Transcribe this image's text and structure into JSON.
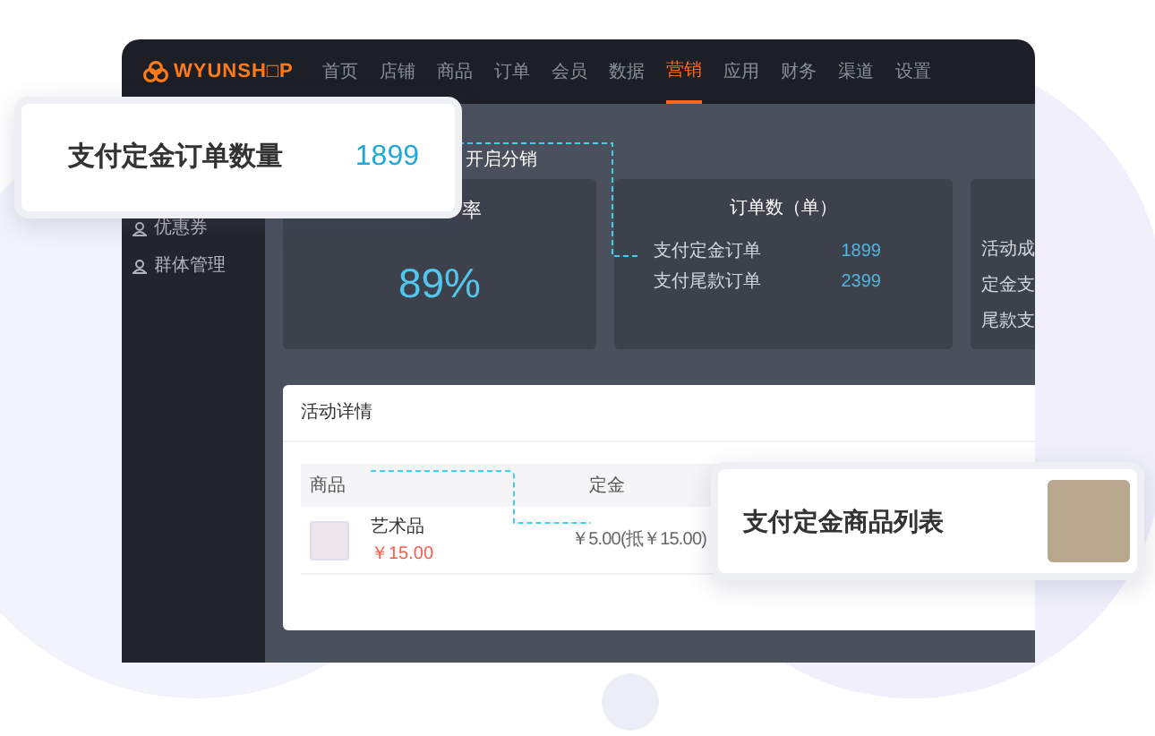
{
  "brand": "WYUNSH□P",
  "nav": [
    {
      "label": "首页",
      "selected": false
    },
    {
      "label": "店铺",
      "selected": false
    },
    {
      "label": "商品",
      "selected": false
    },
    {
      "label": "订单",
      "selected": false
    },
    {
      "label": "会员",
      "selected": false
    },
    {
      "label": "数据",
      "selected": false
    },
    {
      "label": "营销",
      "selected": true
    },
    {
      "label": "应用",
      "selected": false
    },
    {
      "label": "财务",
      "selected": false
    },
    {
      "label": "渠道",
      "selected": false
    },
    {
      "label": "设置",
      "selected": false
    }
  ],
  "sidebar": {
    "items": [
      {
        "label": "优惠券"
      },
      {
        "label": "群体管理"
      }
    ]
  },
  "toggle_label": "开启分销",
  "rate_card": {
    "title": "率",
    "value": "89%"
  },
  "orders_card": {
    "title": "订单数（单）",
    "rows": [
      {
        "label": "支付定金订单",
        "value": "1899"
      },
      {
        "label": "支付尾款订单",
        "value": "2399"
      }
    ]
  },
  "third_card": {
    "rows": [
      "活动成",
      "定金支",
      "尾款支"
    ]
  },
  "details": {
    "title": "活动详情",
    "columns": [
      "商品",
      "定金"
    ],
    "rows": [
      {
        "name": "艺术品",
        "price": "￥15.00",
        "deposit": "￥5.00(抵￥15.00)"
      }
    ]
  },
  "callout_orders": {
    "label": "支付定金订单数量",
    "value": "1899"
  },
  "callout_products": {
    "label": "支付定金商品列表"
  }
}
